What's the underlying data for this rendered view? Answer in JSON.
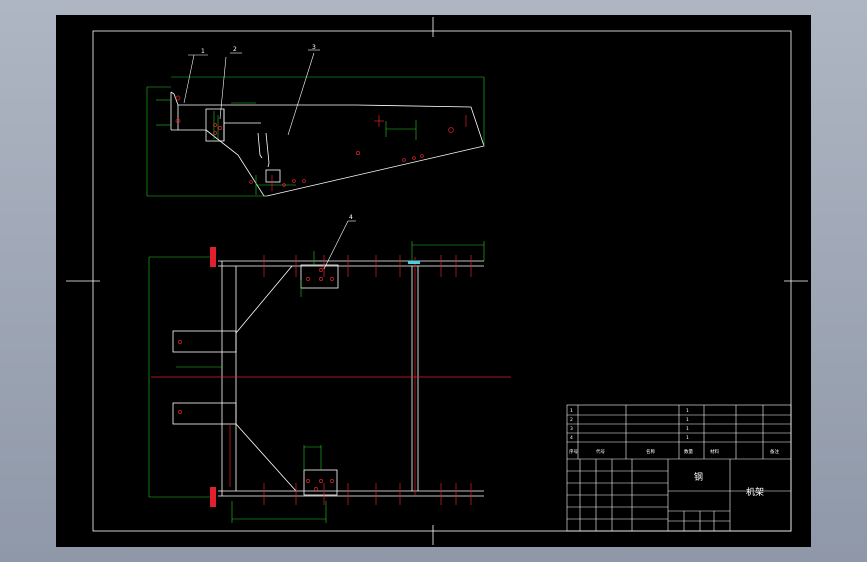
{
  "title_block": {
    "title_cell": "钢",
    "name_cell": "机架",
    "header_cells": [
      "序号",
      "代号",
      "名称",
      "数量",
      "材料",
      "备注"
    ],
    "parts_rows": [
      {
        "no": "1",
        "qty": "1"
      },
      {
        "no": "2",
        "qty": "1"
      },
      {
        "no": "3",
        "qty": "1"
      },
      {
        "no": "4",
        "qty": "1"
      }
    ]
  },
  "balloons": [
    "1",
    "2",
    "3",
    "4"
  ],
  "colors": {
    "outline": "#ffffff",
    "dimension": "#22cc22",
    "centerline": "#e0202a",
    "hole": "#e0202a",
    "background": "#000000"
  }
}
